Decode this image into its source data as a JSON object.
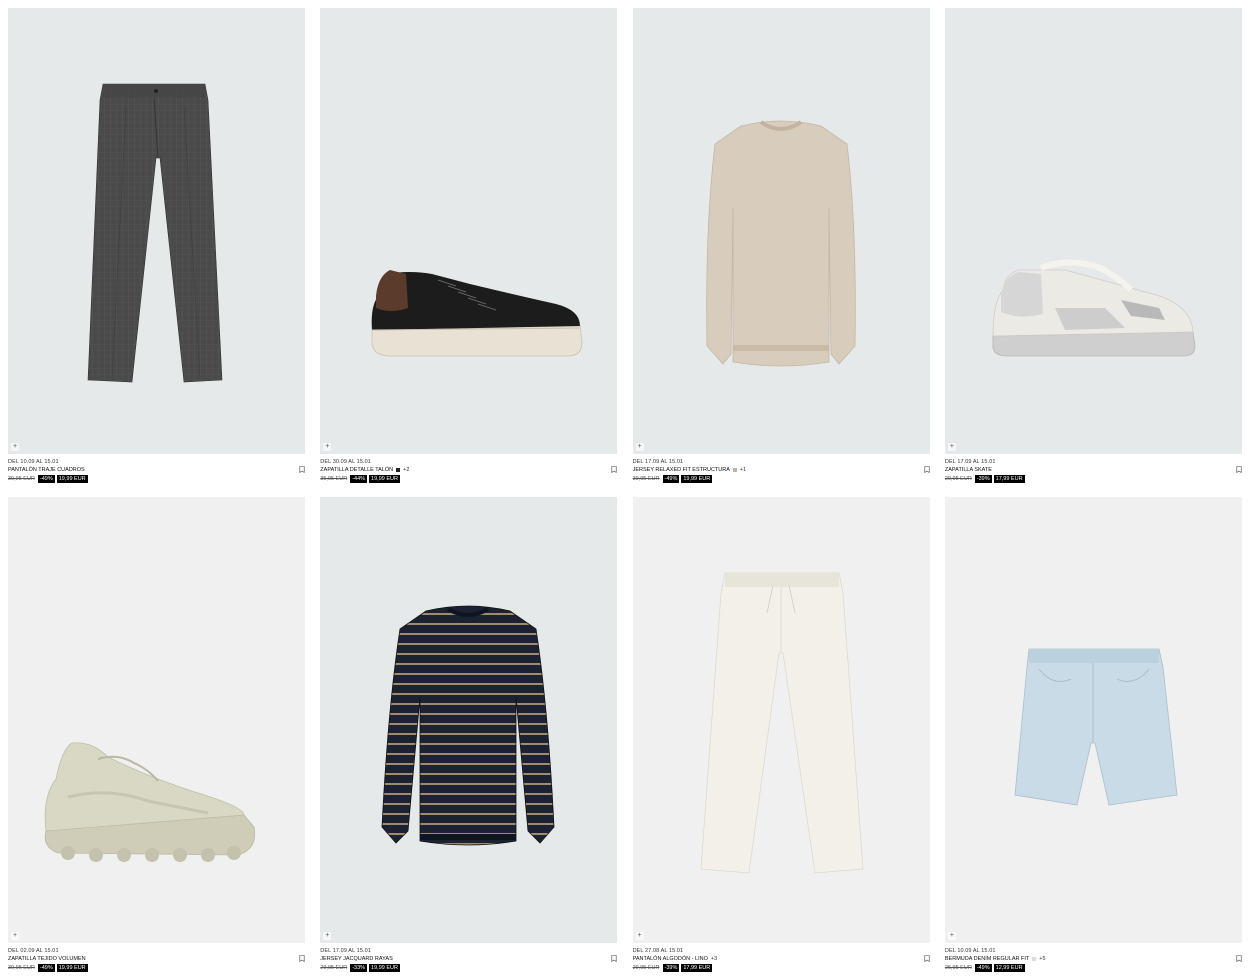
{
  "currency_note": "EUR",
  "products": [
    {
      "dates": "DEL 10.09 AL 15.01",
      "name": "PANTALÓN TRAJE CUADROS",
      "old_price": "39,95 EUR",
      "discount": "-49%",
      "new_price": "19,99 EUR",
      "more_colors": "",
      "swatch_color": "",
      "bg_color": "#e6e9ea",
      "item_icon": "trousers-icon"
    },
    {
      "dates": "DEL 30.09 AL 15.01",
      "name": "ZAPATILLA DETALLE TALÓN",
      "old_price": "35,95 EUR",
      "discount": "-44%",
      "new_price": "19,99 EUR",
      "more_colors": "+2",
      "swatch_color": "#222222",
      "bg_color": "#e6e9ea",
      "item_icon": "sneaker-icon"
    },
    {
      "dates": "DEL 17.09 AL 15.01",
      "name": "JERSEY RELAXED FIT ESTRUCTURA",
      "old_price": "39,95 EUR",
      "discount": "-49%",
      "new_price": "19,99 EUR",
      "more_colors": "+1",
      "swatch_color": "#bdb4a6",
      "bg_color": "#e6e9ea",
      "item_icon": "sweater-icon"
    },
    {
      "dates": "DEL 17.09 AL 15.01",
      "name": "ZAPATILLA SKATE",
      "old_price": "29,95 EUR",
      "discount": "-39%",
      "new_price": "17,99 EUR",
      "more_colors": "",
      "swatch_color": "",
      "bg_color": "#e6e9ea",
      "item_icon": "skate-sneaker-icon"
    },
    {
      "dates": "DEL 02.09 AL 15.01",
      "name": "ZAPATILLA TEJIDO VOLUMEN",
      "old_price": "39,95 EUR",
      "discount": "-49%",
      "new_price": "19,99 EUR",
      "more_colors": "",
      "swatch_color": "",
      "bg_color": "#f0f0f0",
      "item_icon": "chunky-sneaker-icon"
    },
    {
      "dates": "DEL 17.09 AL 15.01",
      "name": "JERSEY JACQUARD RAYAS",
      "old_price": "29,95 EUR",
      "discount": "-33%",
      "new_price": "19,99 EUR",
      "more_colors": "",
      "swatch_color": "",
      "bg_color": "#e6e9ea",
      "item_icon": "striped-sweater-icon"
    },
    {
      "dates": "DEL 27.08 AL 15.01",
      "name": "PANTALÓN ALGODÓN - LINO",
      "old_price": "29,95 EUR",
      "discount": "-39%",
      "new_price": "17,99 EUR",
      "more_colors": "+3",
      "swatch_color": "",
      "bg_color": "#f0f0f0",
      "item_icon": "linen-trousers-icon"
    },
    {
      "dates": "DEL 10.09 AL 15.01",
      "name": "BERMUDA DENIM REGULAR FIT",
      "old_price": "25,95 EUR",
      "discount": "-49%",
      "new_price": "12,99 EUR",
      "more_colors": "+5",
      "swatch_color": "#d6dde0",
      "bg_color": "#f0f0f0",
      "item_icon": "denim-shorts-icon"
    }
  ]
}
